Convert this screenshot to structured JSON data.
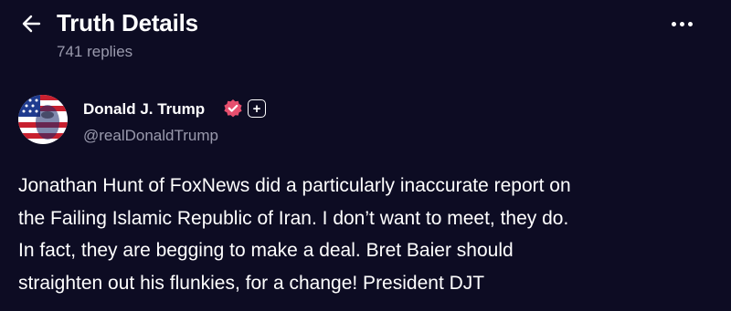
{
  "header": {
    "title": "Truth Details",
    "subtitle": "741 replies",
    "back_icon": "arrow-left-icon",
    "more_icon": "more-horizontal-icon"
  },
  "post": {
    "author": {
      "name": "Donald J. Trump",
      "handle": "@realDonaldTrump",
      "avatar_icon": "profile-avatar",
      "verified_icon": "verified-badge-icon",
      "verified_color": "#e64f6e",
      "follow_icon": "plus-icon",
      "follow_label": "+"
    },
    "text_lines": [
      "Jonathan Hunt of FoxNews did a particularly inaccurate report on",
      "the Failing Islamic Republic of Iran. I don’t want to meet, they do.",
      "In fact, they are begging to make a deal. Bret Baier should",
      "straighten out his flunkies, for a change! President DJT"
    ]
  },
  "colors": {
    "background": "#0d0c23",
    "text_primary": "#ffffff",
    "text_secondary": "#9a9aad"
  }
}
